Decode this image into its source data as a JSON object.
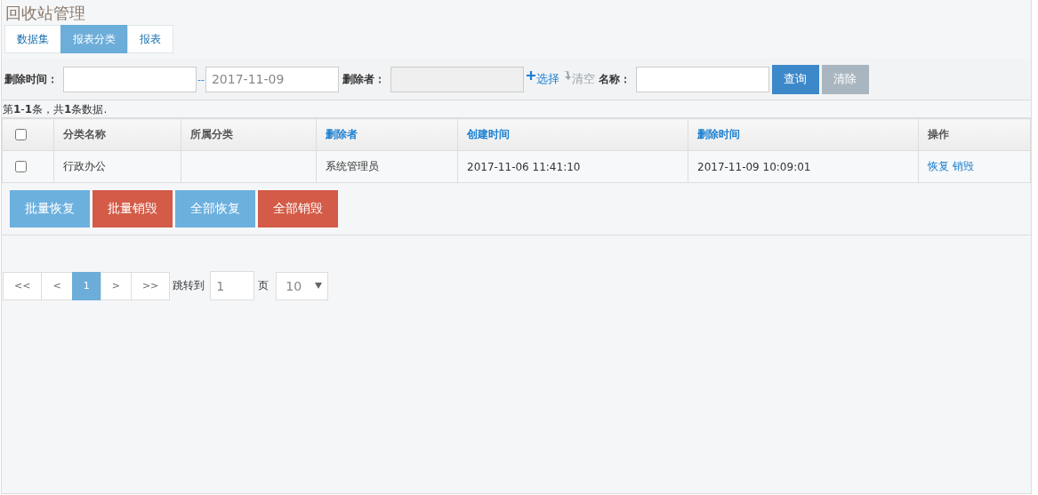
{
  "page_title": "回收站管理",
  "tabs": [
    {
      "label": "数据集",
      "selected": false
    },
    {
      "label": "报表分类",
      "selected": true
    },
    {
      "label": "报表",
      "selected": false
    }
  ],
  "filter": {
    "delete_time_label": "删除时间：",
    "range_separator": "--",
    "date_to": {
      "value": "2017-11-09"
    },
    "deleted_by_label": "删除者：",
    "deleted_by": {
      "disabled": true
    },
    "select_link": "选择",
    "clear_link": {
      "label": "清空",
      "disabled": true
    },
    "name_label": "名称：",
    "buttons": [
      {
        "label": "查询",
        "disabled": false
      },
      {
        "label": "清除",
        "disabled": true
      }
    ]
  },
  "summary": "第**1**-**1**条，共**1**条数据.",
  "table": {
    "columns": [
      {
        "label": "分类名称",
        "sortable": false
      },
      {
        "label": "所属分类",
        "sortable": false
      },
      {
        "label": "删除者",
        "sortable": true
      },
      {
        "label": "创建时间",
        "sortable": true
      },
      {
        "label": "删除时间",
        "sortable": true
      },
      {
        "label": "操作",
        "sortable": false
      }
    ],
    "header_checked": false,
    "rows": [
      {
        "checked": false,
        "cells": [
          "行政办公",
          "",
          "系统管理员",
          "2017-11-06 11:41:10",
          "2017-11-09 10:09:01"
        ],
        "actions": [
          "恢复",
          "销毁"
        ]
      }
    ]
  },
  "bulk_buttons": [
    {
      "label": "批量恢复",
      "kind": "restore"
    },
    {
      "label": "批量销毁",
      "kind": "destroy"
    },
    {
      "label": "全部恢复",
      "kind": "restore"
    },
    {
      "label": "全部销毁",
      "kind": "destroy"
    }
  ],
  "pagination": {
    "pages": [
      {
        "label": "<<",
        "selected": false
      },
      {
        "label": "<",
        "selected": false
      },
      {
        "label": "1",
        "selected": true
      },
      {
        "label": ">",
        "selected": false
      },
      {
        "label": ">>",
        "selected": false
      }
    ],
    "jump_label": "跳转到",
    "jump_value": "1",
    "page_unit": "页",
    "page_size": "10"
  }
}
